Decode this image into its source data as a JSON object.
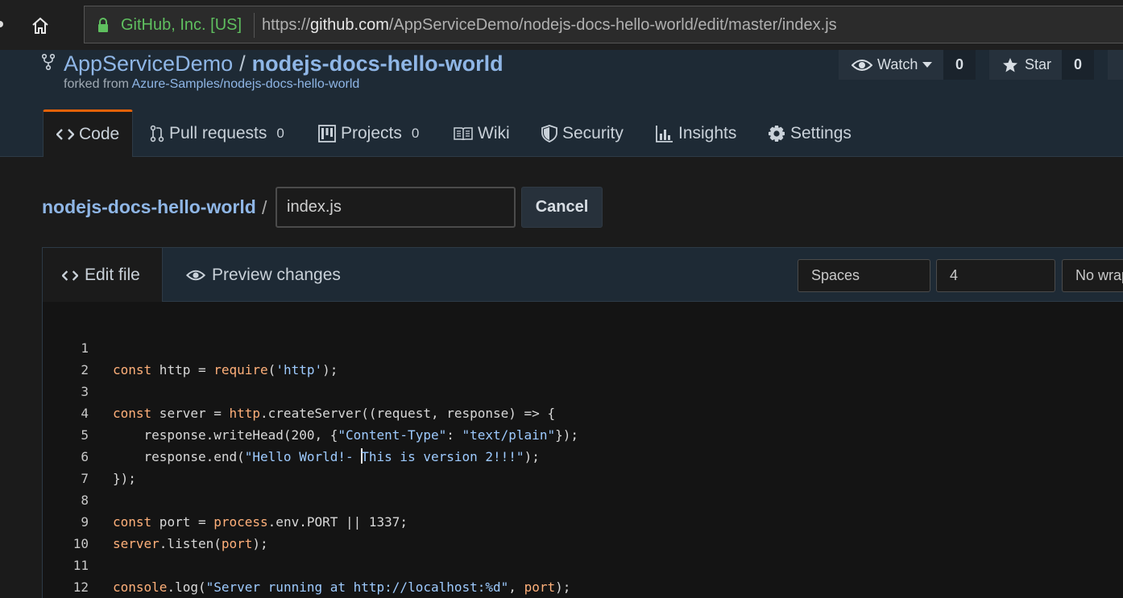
{
  "browser": {
    "cert_label": "GitHub, Inc. [US]",
    "url_prefix": "https://",
    "url_host": "github.com",
    "url_path": "/AppServiceDemo/nodejs-docs-hello-world/edit/master/index.js"
  },
  "repo": {
    "owner": "AppServiceDemo",
    "separator": "/",
    "name": "nodejs-docs-hello-world",
    "forked_prefix": "forked from ",
    "forked_link": "Azure-Samples/nodejs-docs-hello-world",
    "watch_label": "Watch",
    "watch_count": "0",
    "star_label": "Star",
    "star_count": "0"
  },
  "tabs": [
    {
      "label": "Code",
      "count": ""
    },
    {
      "label": "Pull requests",
      "count": "0"
    },
    {
      "label": "Projects",
      "count": "0"
    },
    {
      "label": "Wiki",
      "count": ""
    },
    {
      "label": "Security",
      "count": ""
    },
    {
      "label": "Insights",
      "count": ""
    },
    {
      "label": "Settings",
      "count": ""
    }
  ],
  "breadcrumb": {
    "repo": "nodejs-docs-hello-world",
    "slash": "/",
    "filename": "index.js",
    "cancel_label": "Cancel"
  },
  "editor": {
    "edit_tab": "Edit file",
    "preview_tab": "Preview changes",
    "indent_mode": "Spaces",
    "indent_size": "4",
    "wrap_mode": "No wrap"
  },
  "code_lines": [
    {
      "n": "1"
    },
    {
      "n": "2"
    },
    {
      "n": "3"
    },
    {
      "n": "4"
    },
    {
      "n": "5"
    },
    {
      "n": "6"
    },
    {
      "n": "7"
    },
    {
      "n": "8"
    },
    {
      "n": "9"
    },
    {
      "n": "10"
    },
    {
      "n": "11"
    },
    {
      "n": "12"
    }
  ],
  "code_text": {
    "l1_kw": "const",
    "l1_a": " http = ",
    "l1_fn": "require",
    "l1_b": "(",
    "l1_s": "'http'",
    "l1_c": ");",
    "l3_kw": "const",
    "l3_a": " server = ",
    "l3_fn": "http",
    "l3_b": ".createServer((request, response) => {",
    "l4_a": "    response.writeHead(200, {",
    "l4_s1": "\"Content-Type\"",
    "l4_b": ": ",
    "l4_s2": "\"text/plain\"",
    "l4_c": "});",
    "l5_a": "    response.end(",
    "l5_s1": "\"Hello World!- ",
    "l5_s2": "This is version 2!!!\"",
    "l5_c": ");",
    "l6": "});",
    "l8_kw": "const",
    "l8_a": " port = ",
    "l8_fn": "process",
    "l8_b": ".env.PORT || 1337;",
    "l9_fn": "server",
    "l9_a": ".listen(",
    "l9_p": "port",
    "l9_b": ");",
    "l11_fn": "console",
    "l11_a": ".log(",
    "l11_s": "\"Server running at http://localhost:%d\"",
    "l11_b": ", ",
    "l11_p": "port",
    "l11_c": ");"
  }
}
